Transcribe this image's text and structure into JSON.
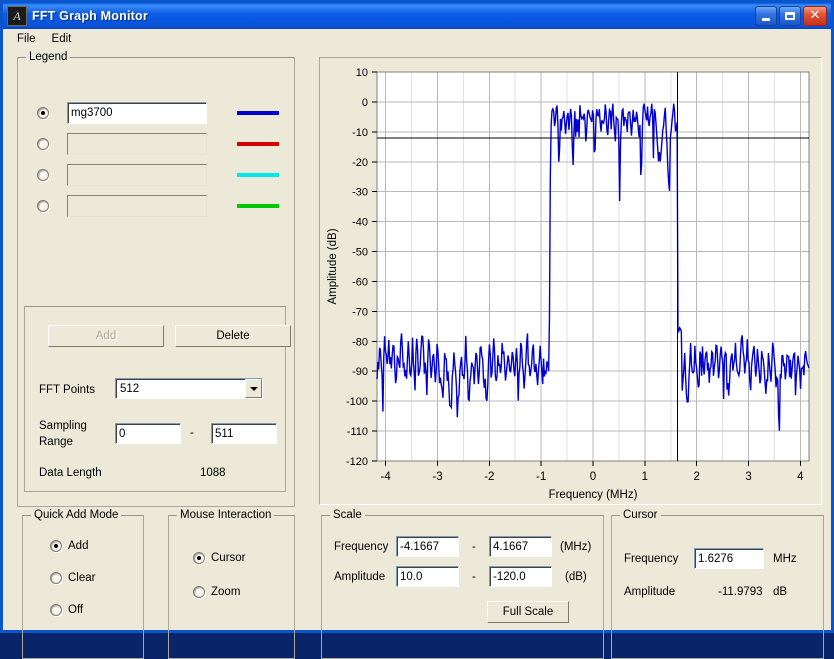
{
  "window": {
    "title": "FFT Graph Monitor",
    "icon": "app-icon",
    "buttons": {
      "minimize": "minimize",
      "maximize": "maximize",
      "close": "close"
    }
  },
  "menu": {
    "items": [
      "File",
      "Edit"
    ]
  },
  "legend": {
    "title": "Legend",
    "rows": [
      {
        "selected": true,
        "name": "mg3700",
        "color": "#0000d2"
      },
      {
        "selected": false,
        "name": "",
        "color": "#d20000"
      },
      {
        "selected": false,
        "name": "",
        "color": "#00eaea"
      },
      {
        "selected": false,
        "name": "",
        "color": "#00c800"
      }
    ],
    "add_label": "Add",
    "delete_label": "Delete",
    "fft_points_label": "FFT Points",
    "fft_points_value": "512",
    "sampling_range_label_line1": "Sampling",
    "sampling_range_label_line2": "Range",
    "sampling_range_from": "0",
    "sampling_range_sep": "-",
    "sampling_range_to": "511",
    "data_length_label": "Data Length",
    "data_length_value": "1088"
  },
  "quick_add": {
    "title": "Quick Add Mode",
    "options": [
      "Add",
      "Clear",
      "Off"
    ],
    "selected": "Add"
  },
  "mouse_interaction": {
    "title": "Mouse Interaction",
    "options": [
      "Cursor",
      "Zoom"
    ],
    "selected": "Cursor"
  },
  "scale": {
    "title": "Scale",
    "frequency_label": "Frequency",
    "frequency_min": "-4.1667",
    "frequency_max": "4.1667",
    "frequency_unit": "(MHz)",
    "amplitude_label": "Amplitude",
    "amplitude_min": "10.0",
    "amplitude_max": "-120.0",
    "amplitude_unit": "(dB)",
    "separator": "-",
    "full_scale_label": "Full Scale"
  },
  "cursor": {
    "title": "Cursor",
    "frequency_label": "Frequency",
    "frequency_value": "1.6276",
    "frequency_unit": "MHz",
    "amplitude_label": "Amplitude",
    "amplitude_value": "-11.9793",
    "amplitude_unit": "dB"
  },
  "chart_data": {
    "type": "line",
    "title": "",
    "xlabel": "Frequency (MHz)",
    "ylabel": "Amplitude (dB)",
    "xlim": [
      -4.1667,
      4.1667
    ],
    "ylim": [
      -120,
      10
    ],
    "xticks": [
      -4,
      -3,
      -2,
      -1,
      0,
      1,
      2,
      3,
      4
    ],
    "yticks": [
      10,
      0,
      -10,
      -20,
      -30,
      -40,
      -50,
      -60,
      -70,
      -80,
      -90,
      -100,
      -110,
      -120
    ],
    "grid": true,
    "legend": "none",
    "line_color": "#0000d2",
    "cursor_vertical_x": 1.6276,
    "cursor_horizontal_y": -11.9793,
    "cursor_color": "#000000",
    "series": [
      {
        "name": "mg3700",
        "description": "FFT spectrum: noise floor near -88 dB outside passband, flat signal band near -5 dB between -1.63 and 1.63 MHz",
        "passband": [
          -1.63,
          1.63
        ],
        "passband_level_db": -5,
        "noise_floor_db": -88,
        "n_points": 512,
        "y": [
          -94,
          -88,
          -85,
          -81,
          -89,
          -95,
          -86,
          -78,
          -83,
          -91,
          -87,
          -80,
          -84,
          -93,
          -86,
          -79,
          -82,
          -97,
          -90,
          -83,
          -86,
          -92,
          -80,
          -76,
          -84,
          -90,
          -88,
          -95,
          -87,
          -81,
          -85,
          -93,
          -86,
          -79,
          -88,
          -96,
          -84,
          -80,
          -87,
          -92,
          -89,
          -83,
          -78,
          -85,
          -91,
          -88,
          -94,
          -86,
          -80,
          -84,
          -90,
          -87,
          -82,
          -88,
          -93,
          -85,
          -79,
          -86,
          -92,
          -88,
          -100,
          -95,
          -89,
          -84,
          -87,
          -91,
          -86,
          -94,
          -103,
          -97,
          -90,
          -85,
          -88,
          -92,
          -107,
          -99,
          -93,
          -87,
          -83,
          -89,
          -95,
          -86,
          -80,
          -88,
          -94,
          -100,
          -92,
          -86,
          -84,
          -90,
          -96,
          -88,
          -82,
          -87,
          -93,
          -86,
          -79,
          -85,
          -91,
          -88,
          -95,
          -103,
          -94,
          -87,
          -83,
          -89,
          -92,
          -86,
          -81,
          -88,
          -94,
          -90,
          -84,
          -87,
          -93,
          -86,
          -80,
          -85,
          -91,
          -98,
          -89,
          -84,
          -88,
          -92,
          -86,
          -82,
          -87,
          -94,
          -88,
          -83,
          -86,
          -91,
          -87,
          -81,
          -85,
          -90,
          -95,
          -88,
          -84,
          -78,
          -83,
          -89,
          -93,
          -86,
          -80,
          -87,
          -92,
          -88,
          -95,
          -90,
          -85,
          -82,
          -88,
          -93,
          -86,
          -94,
          -89,
          -84,
          -87,
          -91,
          -28,
          -2,
          -6,
          -3,
          -8,
          -4,
          -2,
          -7,
          -23,
          -9,
          -4,
          -6,
          -3,
          -7,
          -12,
          -5,
          -3,
          -8,
          -6,
          -4,
          -9,
          -22,
          -7,
          -3,
          -5,
          -10,
          -6,
          -2,
          -4,
          -8,
          -5,
          -3,
          -7,
          -14,
          -6,
          -4,
          -2,
          -9,
          -5,
          -3,
          -7,
          -24,
          -8,
          -4,
          -6,
          -2,
          -5,
          -9,
          -3,
          -7,
          -4,
          -2,
          -6,
          -11,
          -5,
          -3,
          -8,
          -4,
          -2,
          -7,
          -13,
          -5,
          -3,
          -6,
          -33,
          -9,
          -4,
          -2,
          -7,
          -5,
          -3,
          -8,
          -6,
          -2,
          -4,
          -9,
          -5,
          -3,
          -7,
          -4,
          -2,
          -6,
          -10,
          -5,
          -33,
          -8,
          -4,
          -2,
          -7,
          -5,
          -3,
          -9,
          -6,
          -4,
          -2,
          -8,
          -5,
          -3,
          -7,
          -12,
          -19,
          -16,
          -20,
          -14,
          -9,
          -5,
          -3,
          -8,
          -18,
          -23,
          -33,
          -13,
          -7,
          -4,
          -2,
          -6,
          -9,
          -5,
          -3,
          -11,
          -7,
          -28,
          -93,
          -88,
          -85,
          -92,
          -97,
          -103,
          -90,
          -86,
          -83,
          -89,
          -94,
          -87,
          -82,
          -86,
          -91,
          -95,
          -88,
          -84,
          -80,
          -87,
          -93,
          -86,
          -81,
          -85,
          -90,
          -96,
          -88,
          -83,
          -86,
          -92,
          -87,
          -79,
          -84,
          -89,
          -94,
          -86,
          -82,
          -88,
          -93,
          -85,
          -80,
          -86,
          -91,
          -97,
          -89,
          -84,
          -87,
          -92,
          -86,
          -81,
          -85,
          -90,
          -95,
          -88,
          -83,
          -78,
          -84,
          -89,
          -93,
          -87,
          -82,
          -86,
          -91,
          -96,
          -88,
          -84,
          -80,
          -86,
          -92,
          -87,
          -83,
          -89,
          -94,
          -86,
          -81,
          -85,
          -90,
          -102,
          -93,
          -87,
          -83,
          -88,
          -92,
          -86,
          -80,
          -84,
          -89,
          -95,
          -88,
          -105,
          -96,
          -90,
          -85,
          -82,
          -87,
          -93,
          -86,
          -81,
          -85,
          -91,
          -88,
          -94,
          -89,
          -84,
          -87,
          -92,
          -86,
          -82,
          -88,
          -93,
          -90,
          -85,
          -95,
          -88,
          -83,
          -87,
          -92,
          -86
        ]
      }
    ]
  }
}
